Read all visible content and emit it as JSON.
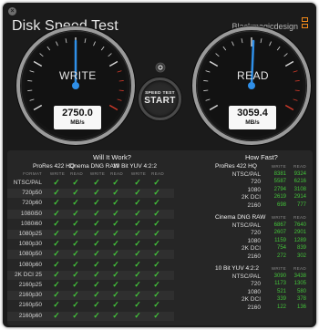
{
  "window": {
    "title": "Disk Speed Test",
    "brand": "Blackmagicdesign",
    "close_icon": "close-icon"
  },
  "gauges": {
    "write": {
      "label": "WRITE",
      "value": "2750.0",
      "unit": "MB/s",
      "needle_fraction": 0.5
    },
    "read": {
      "label": "READ",
      "value": "3059.4",
      "unit": "MB/s",
      "needle_fraction": 0.51
    }
  },
  "start_button": {
    "small_label": "SPEED TEST",
    "label": "START"
  },
  "settings_icon": "gear-icon",
  "will_it_work": {
    "title": "Will It Work?",
    "format_header": "FORMAT",
    "columns": [
      {
        "title": "ProRes 422 HQ",
        "sub": [
          "WRITE",
          "READ"
        ]
      },
      {
        "title": "Cinema DNG RAW",
        "sub": [
          "WRITE",
          "READ"
        ]
      },
      {
        "title": "10 Bit YUV 4:2:2",
        "sub": [
          "WRITE",
          "READ"
        ]
      }
    ],
    "rows": [
      {
        "format": "NTSC/PAL",
        "checks": [
          1,
          1,
          1,
          1,
          1,
          1
        ]
      },
      {
        "format": "720p50",
        "checks": [
          1,
          1,
          1,
          1,
          1,
          1
        ]
      },
      {
        "format": "720p60",
        "checks": [
          1,
          1,
          1,
          1,
          1,
          1
        ]
      },
      {
        "format": "1080i50",
        "checks": [
          1,
          1,
          1,
          1,
          1,
          1
        ]
      },
      {
        "format": "1080i60",
        "checks": [
          1,
          1,
          1,
          1,
          1,
          1
        ]
      },
      {
        "format": "1080p25",
        "checks": [
          1,
          1,
          1,
          1,
          1,
          1
        ]
      },
      {
        "format": "1080p30",
        "checks": [
          1,
          1,
          1,
          1,
          1,
          1
        ]
      },
      {
        "format": "1080p50",
        "checks": [
          1,
          1,
          1,
          1,
          1,
          1
        ]
      },
      {
        "format": "1080p60",
        "checks": [
          1,
          1,
          1,
          1,
          1,
          1
        ]
      },
      {
        "format": "2K DCI 25",
        "checks": [
          1,
          1,
          1,
          1,
          1,
          1
        ]
      },
      {
        "format": "2160p25",
        "checks": [
          1,
          1,
          1,
          1,
          1,
          1
        ]
      },
      {
        "format": "2160p30",
        "checks": [
          1,
          1,
          1,
          1,
          1,
          1
        ]
      },
      {
        "format": "2160p50",
        "checks": [
          1,
          1,
          1,
          1,
          1,
          1
        ]
      },
      {
        "format": "2160p60",
        "checks": [
          1,
          1,
          1,
          1,
          1,
          1
        ]
      }
    ],
    "check_symbol": "✓"
  },
  "how_fast": {
    "title": "How Fast?",
    "groups": [
      {
        "name": "ProRes 422 HQ",
        "sub": [
          "WRITE",
          "READ"
        ],
        "rows": [
          {
            "format": "NTSC/PAL",
            "write": "8381",
            "read": "9324"
          },
          {
            "format": "720",
            "write": "5587",
            "read": "6216"
          },
          {
            "format": "1080",
            "write": "2794",
            "read": "3108"
          },
          {
            "format": "2K DCI",
            "write": "2619",
            "read": "2914"
          },
          {
            "format": "2160",
            "write": "698",
            "read": "777"
          }
        ]
      },
      {
        "name": "Cinema DNG RAW",
        "sub": [
          "WRITE",
          "READ"
        ],
        "rows": [
          {
            "format": "NTSC/PAL",
            "write": "6867",
            "read": "7640"
          },
          {
            "format": "720",
            "write": "2607",
            "read": "2901"
          },
          {
            "format": "1080",
            "write": "1159",
            "read": "1289"
          },
          {
            "format": "2K DCI",
            "write": "754",
            "read": "839"
          },
          {
            "format": "2160",
            "write": "272",
            "read": "302"
          }
        ]
      },
      {
        "name": "10 Bit YUV 4:2:2",
        "sub": [
          "WRITE",
          "READ"
        ],
        "rows": [
          {
            "format": "NTSC/PAL",
            "write": "3090",
            "read": "3438"
          },
          {
            "format": "720",
            "write": "1173",
            "read": "1305"
          },
          {
            "format": "1080",
            "write": "521",
            "read": "580"
          },
          {
            "format": "2K DCI",
            "write": "339",
            "read": "378"
          },
          {
            "format": "2160",
            "write": "122",
            "read": "136"
          }
        ]
      }
    ]
  },
  "colors": {
    "accent_green": "#43c43a",
    "needle_blue": "#2f8fe8",
    "brand_orange": "#f28a1a",
    "redline": "#d23a2a"
  }
}
